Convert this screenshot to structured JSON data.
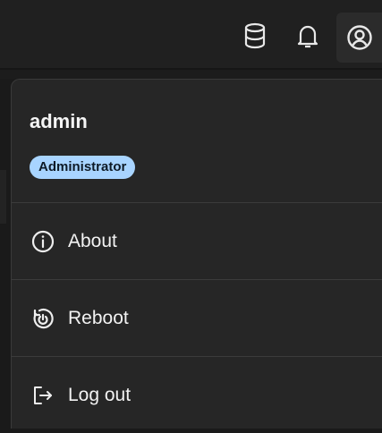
{
  "topbar": {
    "icons": [
      "database-icon",
      "bell-icon",
      "user-circle-icon"
    ]
  },
  "menu": {
    "user": {
      "name": "admin",
      "role": "Administrator"
    },
    "items": [
      {
        "label": "About",
        "icon": "info-icon"
      },
      {
        "label": "Reboot",
        "icon": "power-reboot-icon"
      },
      {
        "label": "Log out",
        "icon": "logout-icon"
      }
    ]
  },
  "colors": {
    "background": "#1a1a1a",
    "panel": "#262626",
    "badge": "#a8d4ff",
    "badge_text": "#0e1a26",
    "text": "#f2f2f2"
  }
}
